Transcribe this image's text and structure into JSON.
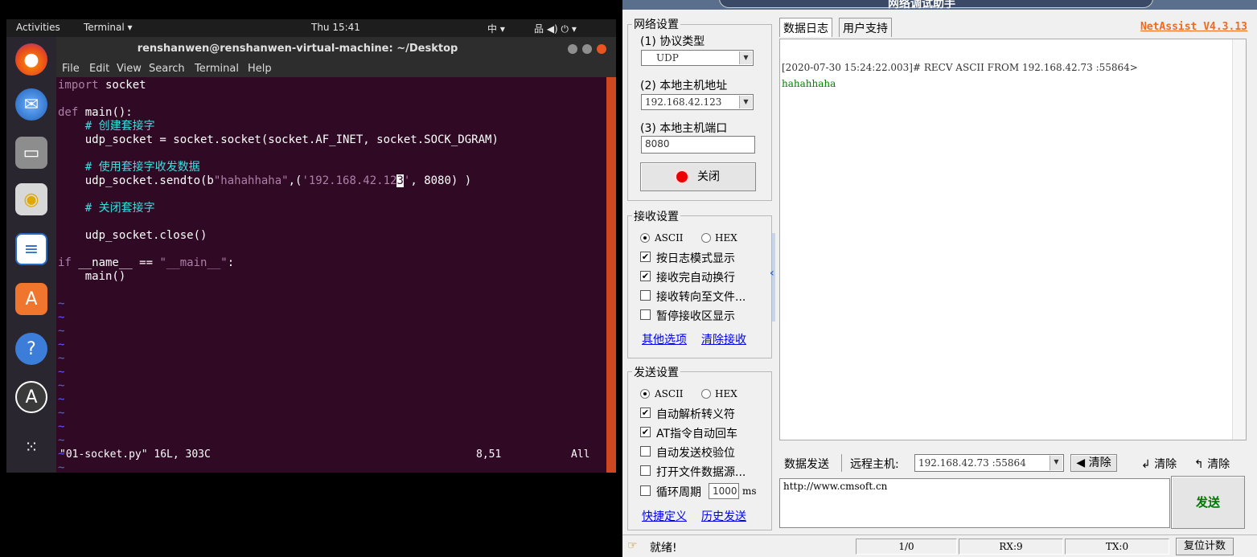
{
  "ubuntu": {
    "topbar": {
      "activities": "Activities",
      "app_menu": "Terminal ▾",
      "clock": "Thu 15:41",
      "input_method": "中 ▾",
      "system_icons": "品 ◀) ⏻ ▾"
    },
    "dock": {
      "icons": [
        "firefox-icon",
        "thunderbird-icon",
        "files-icon",
        "rhythmbox-icon",
        "libreoffice-writer-icon",
        "software-center-icon",
        "help-icon",
        "software-updater-icon",
        "show-apps-icon"
      ]
    },
    "terminal": {
      "title": "renshanwen@renshanwen-virtual-machine: ~/Desktop",
      "menu": [
        "File",
        "Edit",
        "View",
        "Search",
        "Terminal",
        "Help"
      ],
      "code": {
        "line1_kw": "import",
        "line1_rest": " socket",
        "line3_kw": "def",
        "line3_rest": " main():",
        "line4": "    # 创建套接字",
        "line5": "    udp_socket = socket.socket(socket.AF_INET, socket.SOCK_DGRAM)",
        "line7": "    # 使用套接字收发数据",
        "line8_a": "    udp_socket.sendto(b",
        "line8_str": "\"hahahhaha\"",
        "line8_b": ",(",
        "line8_ip": "'192.168.42.12",
        "line8_cursor": "3",
        "line8_ip_end": "'",
        "line8_c": ", 8080) )",
        "line10": "    # 关闭套接字",
        "line12": "    udp_socket.close()",
        "line14_kw": "if",
        "line14_a": " __name__ == ",
        "line14_str": "\"__main__\"",
        "line14_b": ":",
        "line15": "    main()",
        "tilde": "~"
      },
      "status": {
        "file": "\"01-socket.py\" 16L, 303C",
        "position": "8,51",
        "scroll": "All"
      }
    }
  },
  "netassist": {
    "title": "网络调试助手",
    "brand": "NetAssist V4.3.13",
    "network_settings": {
      "group_title": "网络设置",
      "protocol_label": "(1) 协议类型",
      "protocol_value": "UDP",
      "host_label": "(2) 本地主机地址",
      "host_value": "192.168.42.123",
      "port_label": "(3) 本地主机端口",
      "port_value": "8080",
      "close_button": "关闭"
    },
    "receive_settings": {
      "group_title": "接收设置",
      "ascii": "ASCII",
      "hex": "HEX",
      "opt1": "按日志模式显示",
      "opt2": "接收完自动换行",
      "opt3": "接收转向至文件...",
      "opt4": "暂停接收区显示",
      "link1": "其他选项",
      "link2": "清除接收"
    },
    "send_settings": {
      "group_title": "发送设置",
      "ascii": "ASCII",
      "hex": "HEX",
      "opt1": "自动解析转义符",
      "opt2": "AT指令自动回车",
      "opt3": "自动发送校验位",
      "opt4": "打开文件数据源...",
      "opt5": "循环周期",
      "cycle_value": "1000",
      "cycle_unit": "ms",
      "link1": "快捷定义",
      "link2": "历史发送"
    },
    "tabs": {
      "log": "数据日志",
      "support": "用户支持"
    },
    "log": {
      "line1": "[2020-07-30 15:24:22.003]# RECV ASCII FROM 192.168.42.73 :55864>",
      "line2": "hahahhaha"
    },
    "send_bar": {
      "label": "数据发送",
      "remote_label": "远程主机:",
      "remote_value": "192.168.42.73 :55864",
      "clear1": "◀ 清除",
      "clear2": "清除",
      "clear3": "清除",
      "send_text": "http://www.cmsoft.cn",
      "send_button": "发送"
    },
    "statusbar": {
      "status": "就绪!",
      "count": "1/0",
      "rx": "RX:9",
      "tx": "TX:0",
      "reset": "复位计数"
    }
  }
}
